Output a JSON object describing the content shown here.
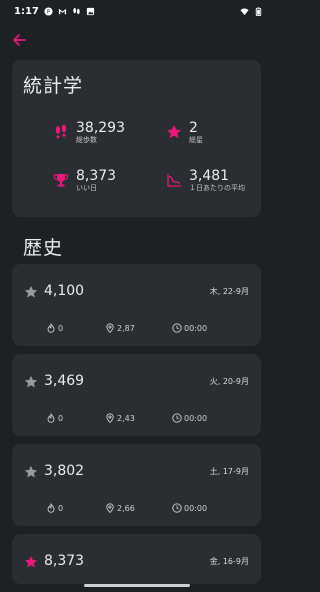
{
  "status_bar": {
    "time": "1:17",
    "icons": [
      "p-circle-icon",
      "gmail-icon",
      "footprints-icon",
      "image-icon",
      "wifi-icon",
      "battery-icon"
    ]
  },
  "app_bar": {
    "back_icon": "arrow-left-icon"
  },
  "stats": {
    "title": "統計学",
    "total_steps": {
      "value": "38,293",
      "label": "総歩数",
      "icon": "footprints-icon"
    },
    "total_stars": {
      "value": "2",
      "label": "総星",
      "icon": "star-icon"
    },
    "good_days": {
      "value": "8,373",
      "label": "いい日",
      "icon": "trophy-icon"
    },
    "daily_average": {
      "value": "3,481",
      "label": "１日あたりの平均",
      "icon": "chart-icon"
    }
  },
  "history": {
    "title": "歴史",
    "entries": [
      {
        "steps": "4,100",
        "date": "木, 22-9月",
        "calories": "0",
        "distance": "2,87",
        "duration": "00:00",
        "starred": false
      },
      {
        "steps": "3,469",
        "date": "火, 20-9月",
        "calories": "0",
        "distance": "2,43",
        "duration": "00:00",
        "starred": false
      },
      {
        "steps": "3,802",
        "date": "土, 17-9月",
        "calories": "0",
        "distance": "2,66",
        "duration": "00:00",
        "starred": false
      },
      {
        "steps": "8,373",
        "date": "金, 16-9月",
        "calories": "",
        "distance": "",
        "duration": "",
        "starred": true
      }
    ]
  },
  "colors": {
    "accent": "#e8197a",
    "background": "#1e2124",
    "card": "#2a2d31",
    "star_inactive": "#9a9a9a"
  }
}
